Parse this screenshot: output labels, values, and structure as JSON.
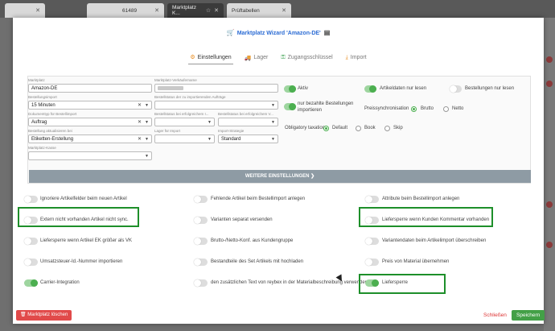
{
  "browser": {
    "tabs": [
      {
        "label": ""
      },
      {
        "label": "61489"
      },
      {
        "label": "Marktplatz K..."
      },
      {
        "label": "Prüftabellen"
      }
    ]
  },
  "modal": {
    "title": "Marktplatz Wizard 'Amazon-DE'",
    "tabs": [
      {
        "label": "Einstellungen"
      },
      {
        "label": "Lager"
      },
      {
        "label": "Zugangsschlüssel"
      },
      {
        "label": "Import"
      }
    ],
    "fields": {
      "marktplatz": {
        "label": "Marktplatz",
        "value": "Amazon-DE"
      },
      "verkaeufername": {
        "label": "Marktplatz-Verkäufername",
        "value": ""
      },
      "bestellungsimport": {
        "label": "Bestellungsimport",
        "value": "15 Minuten"
      },
      "status_import": {
        "label": "Bestellstatus der zu importierenden Aufträge",
        "value": ""
      },
      "dokumenttyp": {
        "label": "Dokumenttyp für Bestellimport",
        "value": "Auftrag"
      },
      "status_erfolg_1": {
        "label": "Bestellstatus bei erfolgreichem I...",
        "value": ""
      },
      "status_erfolg_2": {
        "label": "Bestellstatus bei erfolgreichem V...",
        "value": ""
      },
      "aktualisieren": {
        "label": "Bestellung aktualisieren bei",
        "value": "Etiketten-Erstellung"
      },
      "lager_import": {
        "label": "Lager für Import",
        "value": ""
      },
      "import_strategie": {
        "label": "Import-Strategie",
        "value": "Standard"
      },
      "kasse": {
        "label": "Marktplatz-Kasse",
        "value": ""
      }
    },
    "switches": {
      "aktiv": "Aktiv",
      "nur_bezahlte": "nur bezahlte Bestellungen importieren",
      "artikeldaten": "Artikeldaten nur lesen",
      "bestellungen_lesen": "Bestellungen nur lesen"
    },
    "preis_sync": {
      "label": "Preissynchronisation",
      "options": [
        "Brutto",
        "Netto"
      ]
    },
    "obligatory": {
      "label": "Obligatory taxation",
      "options": [
        "Default",
        "Book",
        "Skip"
      ]
    },
    "more_button": "WEITERE EINSTELLUNGEN ❯",
    "options": [
      "Ignoriere Artikelfelder beim neuen Artikel",
      "Fehlende Artikel beim Bestellimport anlegen",
      "Attribute beim Bestellimport anlegen",
      "Extern nicht vorhanden Artikel nicht sync.",
      "Varianten separat versenden",
      "Liefersperre wenn Kunden Kommentar vorhanden",
      "Liefersperre wenn Artikel EK größer als VK",
      "Brutto-/Netto-Konf. aus Kundengruppe",
      "Variantendaten beim Artikelimport überschreiben",
      "Umsatzsteuer-Id.-Nummer importieren",
      "Bestandteile des Set Artikels mit hochladen",
      "Preis von Material übernehmen",
      "Carrier-Integration",
      "den zusätzlichen Text von reybex in der Materialbeschreibung verwenden",
      "Liefersperre"
    ],
    "footer": {
      "delete": "Marktplatz löschen",
      "close": "Schließen",
      "save": "Speichern"
    }
  }
}
